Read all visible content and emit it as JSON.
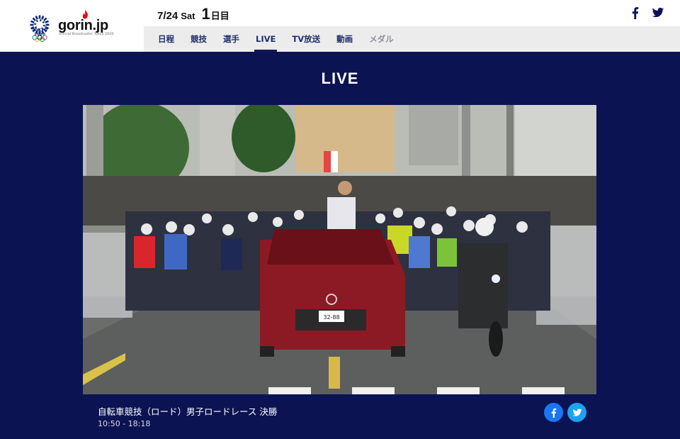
{
  "header": {
    "emblem_text": "TOKYO 2020",
    "brand": "gorin.jp",
    "brand_sub": "Official Broadcaster Tokyo 2020",
    "date": {
      "month_day": "7/24",
      "weekday": "Sat",
      "day_number": "1",
      "day_suffix": "日目"
    },
    "social": {
      "facebook_icon": "facebook-icon",
      "twitter_icon": "twitter-icon"
    }
  },
  "nav": {
    "items": [
      {
        "label": "日程",
        "state": "normal"
      },
      {
        "label": "競技",
        "state": "normal"
      },
      {
        "label": "選手",
        "state": "normal"
      },
      {
        "label": "LIVE",
        "state": "active"
      },
      {
        "label": "TV放送",
        "state": "normal"
      },
      {
        "label": "動画",
        "state": "normal"
      },
      {
        "label": "メダル",
        "state": "disabled"
      }
    ]
  },
  "main": {
    "title": "LIVE",
    "stream": {
      "event_title": "自転車競技（ロード）男子ロードレース 決勝",
      "time_range": "10:50 - 18:18",
      "plate_text": "32-88"
    },
    "share": {
      "facebook_icon": "facebook-icon",
      "twitter_icon": "twitter-icon"
    }
  },
  "colors": {
    "main_bg": "#0c1352",
    "nav_bg": "#ececec",
    "nav_text": "#1f2f6b",
    "nav_disabled": "#8f8f9a",
    "facebook_blue": "#1877f2",
    "twitter_blue": "#1da1f2",
    "flame_red": "#e60012"
  }
}
